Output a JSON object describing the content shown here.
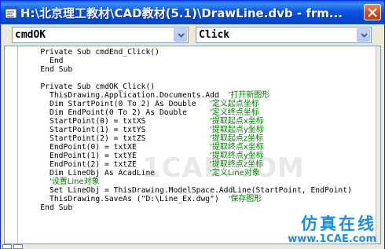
{
  "window": {
    "title": "H:\\北京理工教材\\CAD教材(5.1)\\DrawLine.dvb - frm..."
  },
  "toolbar": {
    "object_combo": "cmdOK",
    "procedure_combo": "Click"
  },
  "code": {
    "lines": [
      {
        "code": "    Private Sub cmdEnd_Click()",
        "comment": ""
      },
      {
        "code": "      End",
        "comment": ""
      },
      {
        "code": "    End Sub",
        "comment": ""
      },
      {
        "code": "",
        "comment": ""
      },
      {
        "code": "    Private Sub cmdOK_Click()",
        "comment": ""
      },
      {
        "code": "      ThisDrawing.Application.Documents.Add  ",
        "comment": "'打开新图形"
      },
      {
        "code": "      Dim StartPoint(0 To 2) As Double   ",
        "comment": "'定义起点坐标"
      },
      {
        "code": "      Dim EndPoint(0 To 2) As Double     ",
        "comment": "'定义终点坐标"
      },
      {
        "code": "      StartPoint(0) = txtXS              ",
        "comment": "'提取起点x坐标"
      },
      {
        "code": "      StartPoint(1) = txtYS              ",
        "comment": "'提取起点y坐标"
      },
      {
        "code": "      StartPoint(2) = txtZS              ",
        "comment": "'提取起点z坐标"
      },
      {
        "code": "      EndPoint(0) = txtXE                ",
        "comment": "'提取终点x坐标"
      },
      {
        "code": "      EndPoint(1) = txtYE                ",
        "comment": "'提取终点y坐标"
      },
      {
        "code": "      EndPoint(2) = txtZE                ",
        "comment": "'提取终点z坐标"
      },
      {
        "code": "      Dim LineObj As AcadLine            ",
        "comment": "'定义Line对象"
      },
      {
        "code": "      ",
        "comment": "'设置Line对象"
      },
      {
        "code": "      Set LineObj = ThisDrawing.ModelSpace.AddLine(StartPoint, EndPoint)",
        "comment": ""
      },
      {
        "code": "      ThisDrawing.SaveAs (\"D:\\Line_Ex.dwg\")  ",
        "comment": "'保存图形"
      },
      {
        "code": "    End Sub",
        "comment": ""
      }
    ]
  },
  "watermark": {
    "text": "1CAE.COM"
  },
  "brand": {
    "line1": "仿真在线",
    "line2": "www.1CAE.com"
  }
}
